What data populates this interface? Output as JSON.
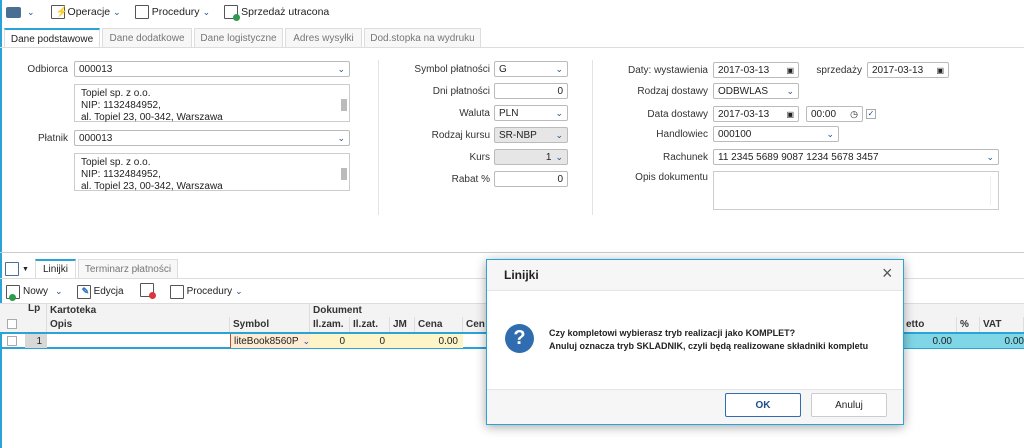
{
  "toolbar": {
    "operacje": "Operacje",
    "procedury": "Procedury",
    "sprzedaz": "Sprzedaż utracona"
  },
  "tabs": [
    "Dane podstawowe",
    "Dane dodatkowe",
    "Dane logistyczne",
    "Adres wysyłki",
    "Dod.stopka na wydruku"
  ],
  "form": {
    "odbiorca_label": "Odbiorca",
    "odbiorca": "000013",
    "odbiorca_addr": [
      "Topiel sp. z o.o.",
      "NIP: 1132484952,",
      "al. Topiel 23, 00-342, Warszawa"
    ],
    "platnik_label": "Płatnik",
    "platnik": "000013",
    "platnik_addr": [
      "Topiel sp. z o.o.",
      "NIP: 1132484952,",
      "al. Topiel 23, 00-342, Warszawa"
    ],
    "symbol_label": "Symbol płatności",
    "symbol": "G",
    "dni_label": "Dni płatności",
    "dni": "0",
    "waluta_label": "Waluta",
    "waluta": "PLN",
    "rodzaj_kursu_label": "Rodzaj kursu",
    "rodzaj_kursu": "SR-NBP",
    "kurs_label": "Kurs",
    "kurs": "1",
    "rabat_label": "Rabat %",
    "rabat": "0",
    "daty_label": "Daty: wystawienia",
    "data_wyst": "2017-03-13",
    "sprzedazy_label": "sprzedaży",
    "data_sprz": "2017-03-13",
    "rodzaj_dostawy_label": "Rodzaj dostawy",
    "rodzaj_dostawy": "ODBWLAS",
    "data_dostawy_label": "Data dostawy",
    "data_dostawy": "2017-03-13",
    "godzina": "00:00",
    "handlowiec_label": "Handlowiec",
    "handlowiec": "000100",
    "rachunek_label": "Rachunek",
    "rachunek": "11 2345 5689 9087 1234 5678 3457",
    "opis_label": "Opis dokumentu"
  },
  "bottom_tabs": [
    "Linijki",
    "Terminarz płatności"
  ],
  "bottom_toolbar": {
    "nowy": "Nowy",
    "edycja": "Edycja",
    "procedury": "Procedury"
  },
  "grid": {
    "group": {
      "lp": "Lp",
      "kartoteka": "Kartoteka",
      "dokument": "Dokument"
    },
    "cols": {
      "opis": "Opis",
      "symbol": "Symbol",
      "ilzam": "Il.zam.",
      "ilzat": "Il.zat.",
      "jm": "JM",
      "cena": "Cena",
      "cen": "Cen",
      "netto": "etto",
      "pct": "%",
      "vat": "VAT"
    },
    "row": {
      "lp": "1",
      "opis": "",
      "symbol": "liteBook8560P",
      "ilzam": "0",
      "ilzat": "0",
      "cena": "0.00",
      "netto": "0.00",
      "vat": "0.00"
    }
  },
  "dialog": {
    "title": "Linijki",
    "line1": "Czy kompletowi wybierasz tryb realizacji jako KOMPLET?",
    "line2": "Anuluj oznacza tryb SKLADNIK, czyli będą realizowane składniki kompletu",
    "ok": "OK",
    "cancel": "Anuluj"
  }
}
